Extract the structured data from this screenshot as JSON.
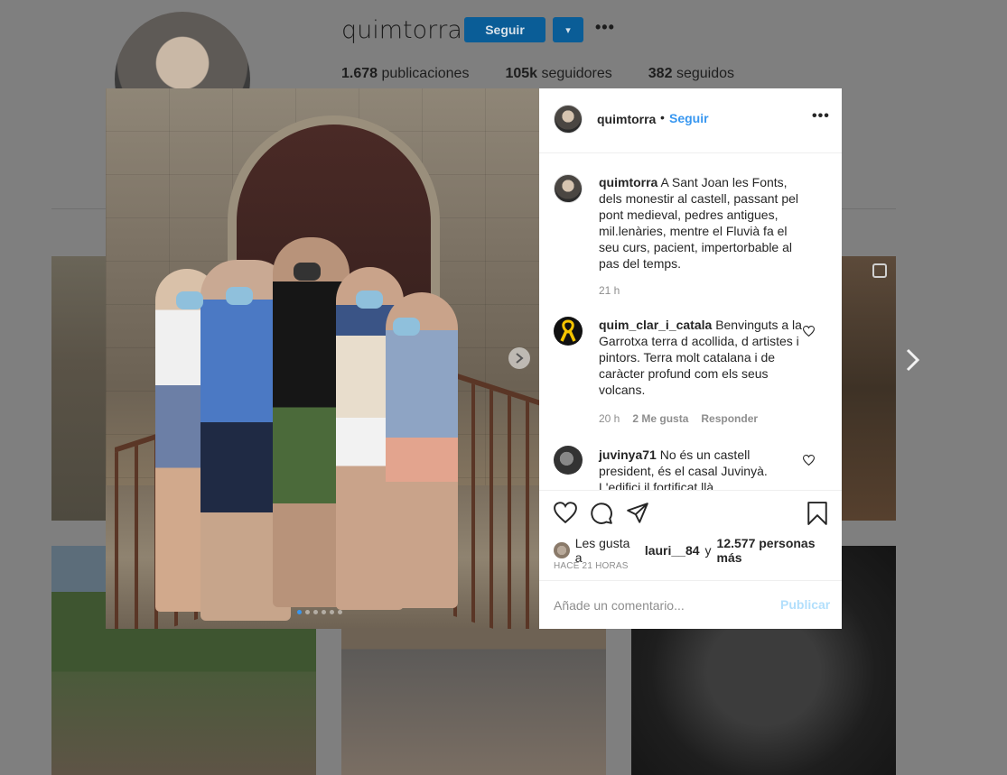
{
  "profile": {
    "username": "quimtorra",
    "follow_label": "Seguir",
    "dropdown_glyph": "▾",
    "more_glyph": "•••",
    "stats": [
      {
        "value": "1.678",
        "label": "publicaciones"
      },
      {
        "value": "105k",
        "label": "seguidores"
      },
      {
        "value": "382",
        "label": "seguidos"
      }
    ]
  },
  "post": {
    "header": {
      "username": "quimtorra",
      "separator": "•",
      "follow_label": "Seguir",
      "more_glyph": "•••"
    },
    "caption": {
      "username": "quimtorra",
      "text": "A Sant Joan les Fonts, dels monestir al castell, passant pel pont medieval, pedres antigues, mil.lenàries, mentre el Fluvià fa el seu curs, pacient, impertorbable al pas del temps.",
      "time": "21 h"
    },
    "comments": [
      {
        "username": "quim_clar_i_catala",
        "text": "Benvinguts a la Garrotxa terra d acollida, d artistes i pintors. Terra molt catalana i de caràcter profund com els seus volcans.",
        "time": "20 h",
        "likes": "2 Me gusta",
        "reply": "Responder"
      },
      {
        "username": "juvinya71",
        "text": "No és un castell president, és el casal Juvinyà. L'edifici il fortificat llà..."
      }
    ],
    "likes": {
      "prefix": "Les gusta a",
      "user": "lauri__84",
      "middle": "y",
      "count": "12.577 personas más"
    },
    "time_ago": "HACE 21 HORAS",
    "comment_input": {
      "placeholder": "Añade un comentario...",
      "publish_label": "Publicar"
    },
    "carousel": {
      "total": 6,
      "current": 1
    }
  },
  "colors": {
    "accent": "#3897f0",
    "publish_disabled": "#b2dffc",
    "follow_bg_dimmed": "#0a5d97"
  }
}
